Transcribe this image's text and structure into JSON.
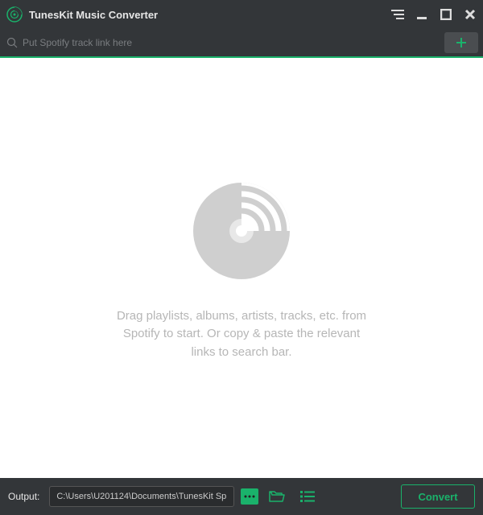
{
  "app": {
    "title": "TunesKit Music Converter"
  },
  "search": {
    "placeholder": "Put Spotify track link here"
  },
  "empty": {
    "line1": "Drag playlists, albums, artists, tracks, etc. from",
    "line2": "Spotify to start. Or copy & paste the relevant",
    "line3": "links to search bar."
  },
  "footer": {
    "output_label": "Output:",
    "output_path": "C:\\Users\\U201124\\Documents\\TunesKit Sp",
    "convert_label": "Convert"
  },
  "colors": {
    "accent": "#1ab26b"
  }
}
